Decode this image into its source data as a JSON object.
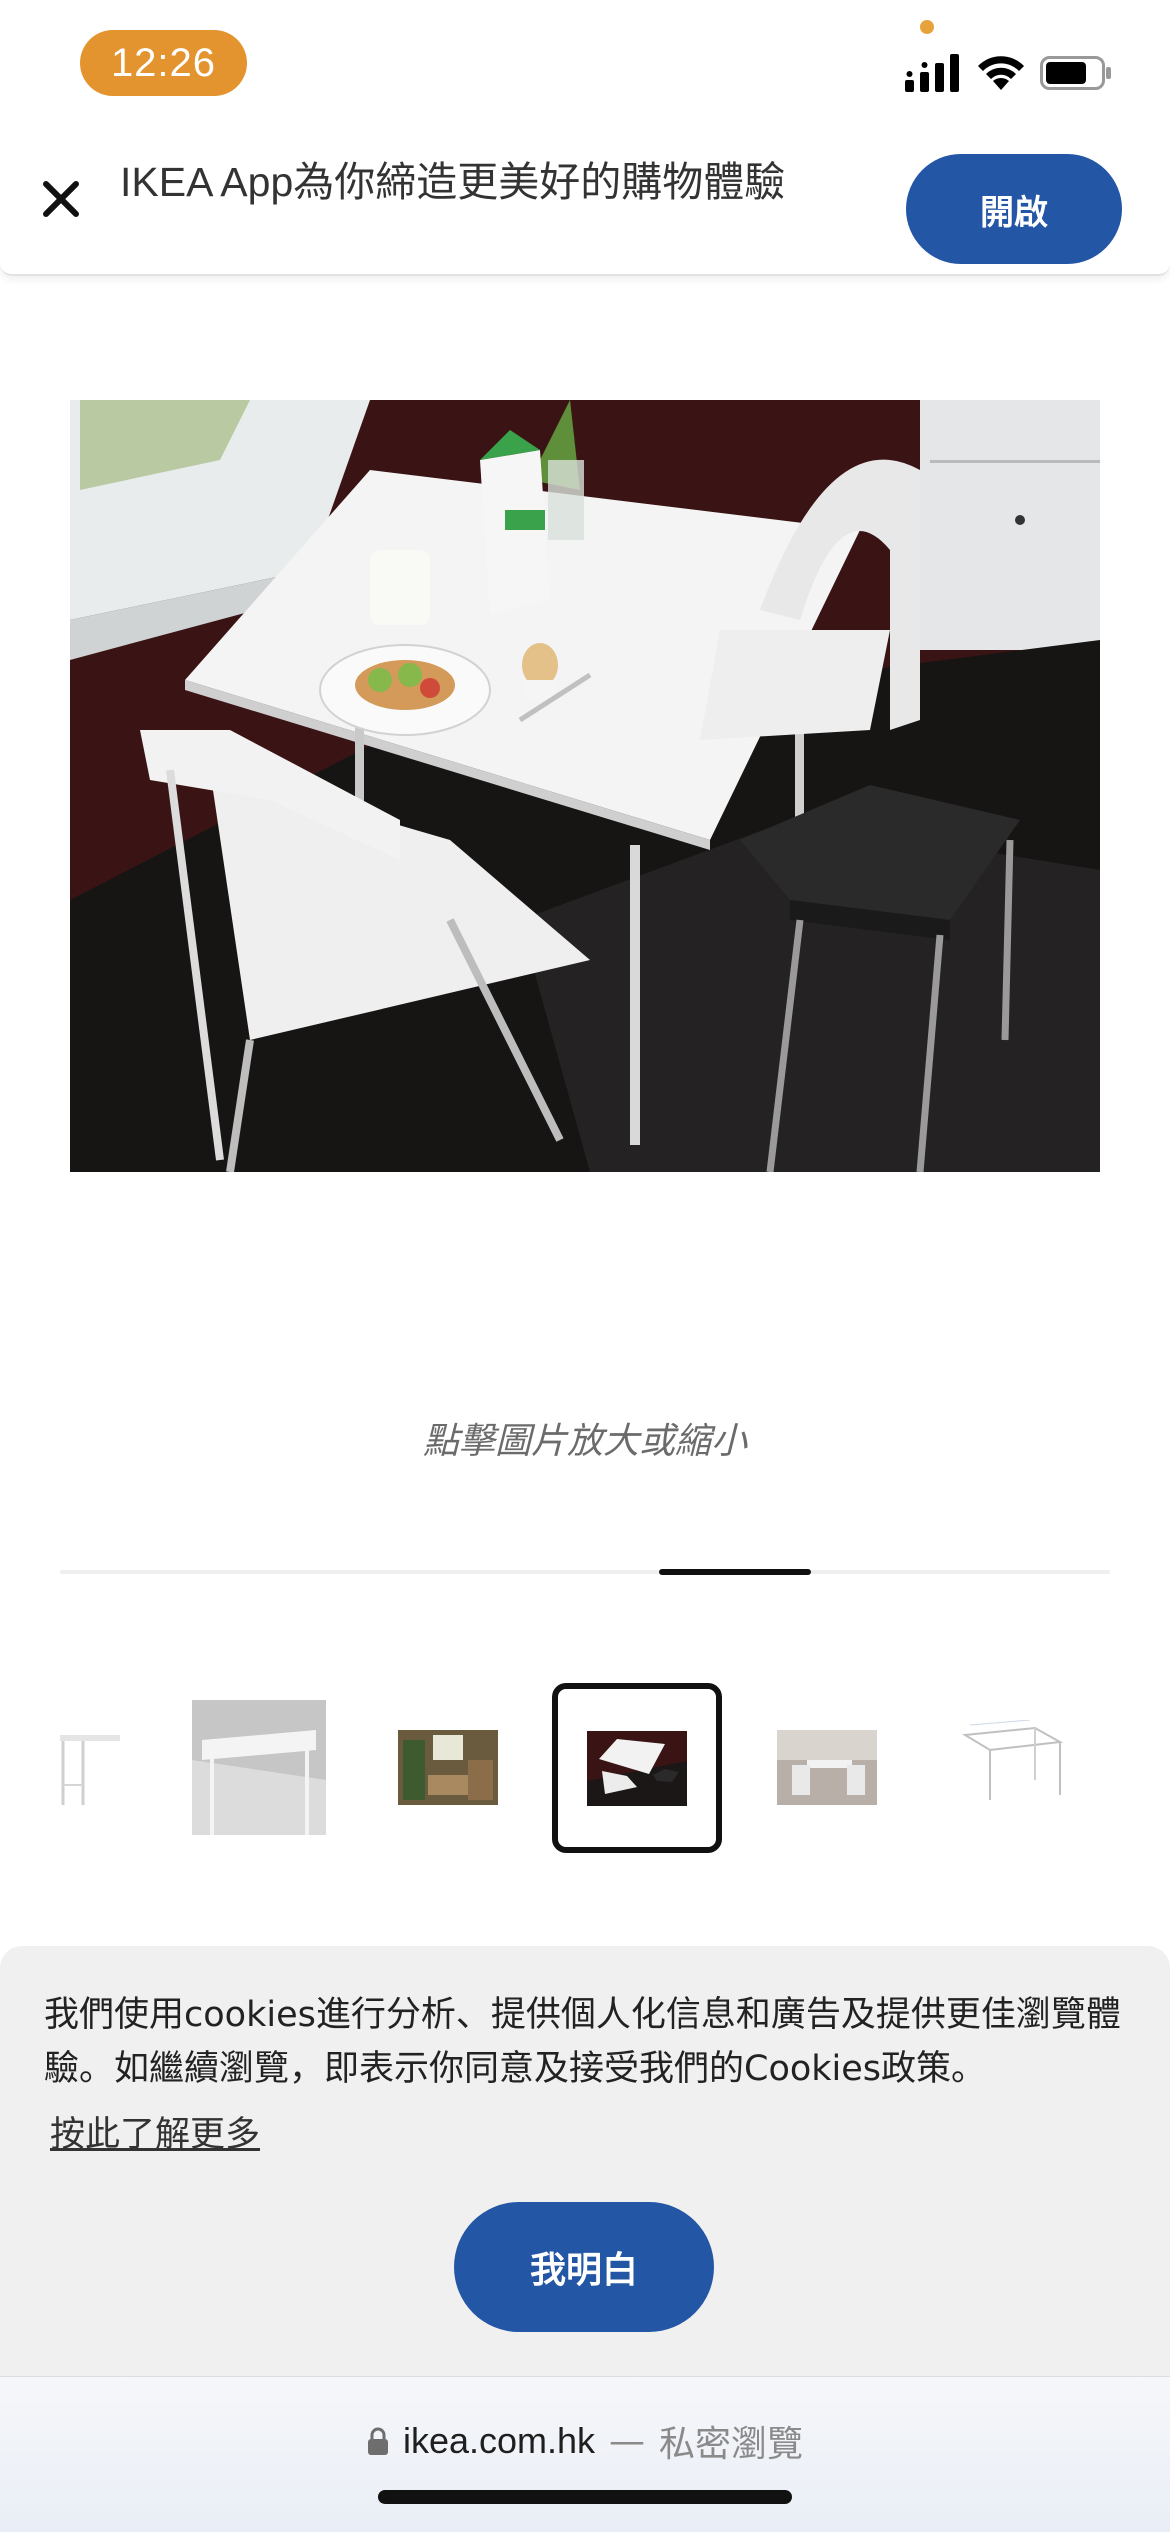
{
  "status_bar": {
    "time": "12:26",
    "icons": [
      "cellular-signal-icon",
      "wifi-icon",
      "battery-icon"
    ],
    "accent_color": "#e3942f"
  },
  "app_banner": {
    "close_icon": "close-icon",
    "text": "IKEA App為你締造更美好的購物體驗",
    "open_label": "開啟",
    "button_color": "#2356a5"
  },
  "product_gallery": {
    "zoom_hint": "點擊圖片放大或縮小",
    "selected_thumbnail": 4,
    "thumbnail_count": 6
  },
  "cookie_notice": {
    "text": "我們使用cookies進行分析、提供個人化信息和廣告及提供更佳瀏覽體驗。如繼續瀏覽，即表示你同意及接受我們的Cookies政策。",
    "learn_more": "按此了解更多",
    "accept_label": "我明白"
  },
  "browser_bar": {
    "lock_icon": "lock-icon",
    "url": "ikea.com.hk",
    "separator": "—",
    "mode": "私密瀏覽"
  }
}
